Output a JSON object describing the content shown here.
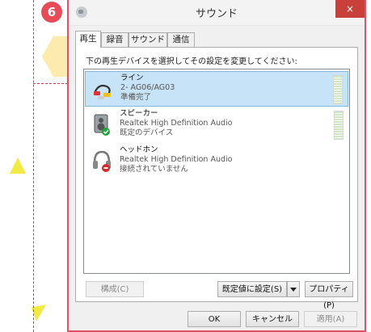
{
  "step_badge": "6",
  "window": {
    "title": "サウンド",
    "close_label": "×"
  },
  "tabs": [
    {
      "label": "再生",
      "active": true
    },
    {
      "label": "録音",
      "active": false
    },
    {
      "label": "サウンド",
      "active": false
    },
    {
      "label": "通信",
      "active": false
    }
  ],
  "instruction": "下の再生デバイスを選択してその設定を変更してください:",
  "devices": [
    {
      "name": "ライン",
      "description": "2- AG06/AG03",
      "status": "準備完了",
      "icon": "line-cable-icon",
      "selected": true
    },
    {
      "name": "スピーカー",
      "description": "Realtek High Definition Audio",
      "status": "既定のデバイス",
      "icon": "speaker-icon",
      "selected": false
    },
    {
      "name": "ヘッドホン",
      "description": "Realtek High Definition Audio",
      "status": "接続されていません",
      "icon": "headphones-icon",
      "selected": false
    }
  ],
  "panel_buttons": {
    "configure": "構成(C)",
    "set_default": "既定値に設定(S)",
    "properties": "プロパティ(P)"
  },
  "dialog_buttons": {
    "ok": "OK",
    "cancel": "キャンセル",
    "apply": "適用(A)"
  },
  "colors": {
    "accent_red": "#e0353f",
    "selection": "#c7e3f7",
    "close_button": "#c9403a"
  }
}
